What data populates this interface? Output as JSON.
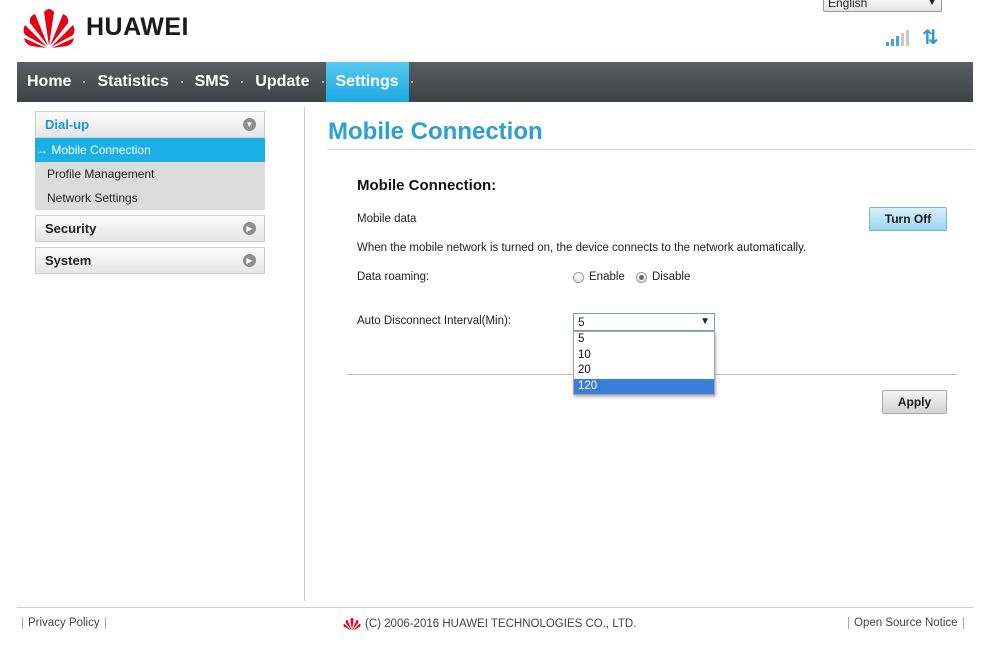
{
  "header": {
    "brand": "HUAWEI",
    "language": "English",
    "signal_bars": 3,
    "signal_bars_total": 5
  },
  "nav": {
    "items": [
      {
        "label": "Home"
      },
      {
        "label": "Statistics"
      },
      {
        "label": "SMS"
      },
      {
        "label": "Update"
      },
      {
        "label": "Settings"
      }
    ],
    "active": "Settings"
  },
  "sidebar": {
    "dialup": {
      "label": "Dial-up",
      "items": [
        {
          "label": "Mobile Connection"
        },
        {
          "label": "Profile Management"
        },
        {
          "label": "Network Settings"
        }
      ]
    },
    "security": {
      "label": "Security"
    },
    "system": {
      "label": "System"
    }
  },
  "main": {
    "page_title": "Mobile Connection",
    "section_title": "Mobile Connection:",
    "mobile_data_label": "Mobile data",
    "turn_off_label": "Turn Off",
    "info_text": "When the mobile network is turned on, the device connects to the network automatically.",
    "roaming_label": "Data roaming:",
    "roaming_enable": "Enable",
    "roaming_disable": "Disable",
    "roaming_selected": "Disable",
    "interval_label": "Auto Disconnect Interval(Min):",
    "interval_value": "5",
    "interval_options": [
      "5",
      "10",
      "20",
      "120"
    ],
    "interval_highlighted": "120",
    "apply_label": "Apply"
  },
  "footer": {
    "privacy": "Privacy Policy",
    "copyright": "(C) 2006-2016 HUAWEI TECHNOLOGIES CO., LTD.",
    "open_source": "Open Source Notice"
  },
  "colors": {
    "brand_red": "#e60012",
    "accent_blue": "#1ab0e6",
    "title_blue": "#2aa0d3"
  }
}
